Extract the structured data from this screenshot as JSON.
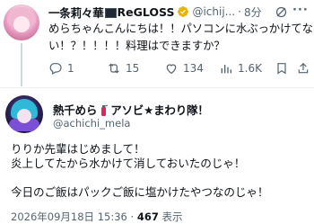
{
  "quoted_tweet": {
    "author_name": "一条莉々華",
    "author_name_suffix": "ReGLOSS",
    "handle": "@ichij...",
    "time_ago": "8分",
    "text_lines": [
      "めらちゃんこんにちは！！パソコンに水ぶっかけてな",
      "い！？！！！！料理はできますか？"
    ],
    "actions": {
      "reply_count": "1",
      "retweet_count": "15",
      "like_count": "134",
      "views_count": "1.6K"
    }
  },
  "reply_tweet": {
    "author_name_prefix": "熱千めら",
    "author_name_suffix": "アソビ★まわり隊！",
    "handle": "@achichi_mela",
    "body_lines": [
      "りりか先輩はじめまして！",
      "炎上してたから水かけて消しておいたのじゃ！",
      "今日のご飯はパックご飯に塩かけたやつなのじゃ！"
    ],
    "date": "2026年09月18日 15:36",
    "view_count": "467",
    "view_label": "表示"
  },
  "colors": {
    "text": "#0f1419",
    "muted": "#536471",
    "divider": "#eff3f4",
    "gold_badge": "#e8b400"
  }
}
